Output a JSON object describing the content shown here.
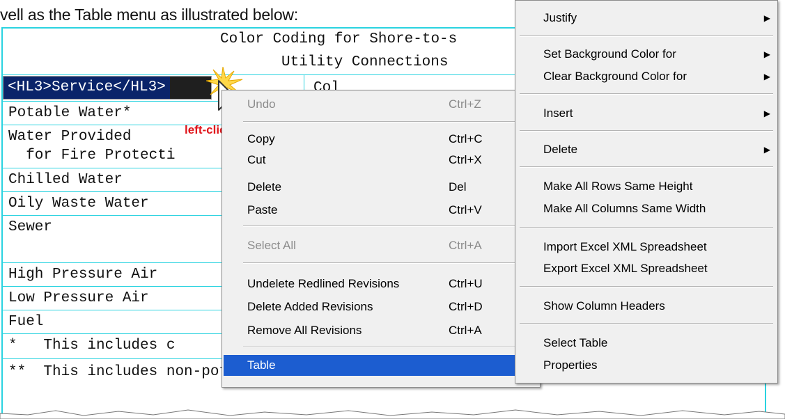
{
  "intro_text": "vell as the Table menu as illustrated below:",
  "document": {
    "title_line1": "Color Coding for Shore-to-s",
    "title_line2": "Utility Connections",
    "selected_cell": "<HL3>Service</HL3>",
    "col2_partial": "Col",
    "rows": [
      "Potable Water*",
      "Water Provided",
      "  for Fire Protecti",
      "Chilled Water",
      "Oily Waste Water",
      "Sewer",
      "",
      "High Pressure Air",
      "Low Pressure Air",
      "Fuel"
    ],
    "footnote1": "*   This includes c",
    "footnote2": "**  This includes non-potalbe salt water or, at some locations,"
  },
  "annotation": "left-click",
  "context_menu": {
    "items": [
      {
        "label": "Undo",
        "shortcut": "Ctrl+Z",
        "disabled": true
      },
      {
        "label": "Copy",
        "shortcut": "Ctrl+C"
      },
      {
        "label": "Cut",
        "shortcut": "Ctrl+X"
      },
      {
        "label": "Delete",
        "shortcut": "Del"
      },
      {
        "label": "Paste",
        "shortcut": "Ctrl+V"
      },
      {
        "label": "Select All",
        "shortcut": "Ctrl+A",
        "disabled": true
      },
      {
        "label": "Undelete Redlined Revisions",
        "shortcut": "Ctrl+U"
      },
      {
        "label": "Delete Added Revisions",
        "shortcut": "Ctrl+D"
      },
      {
        "label": "Remove All Revisions",
        "shortcut": "Ctrl+A"
      },
      {
        "label": "Table",
        "submenu_arrow": "▶",
        "highlighted": true
      }
    ]
  },
  "table_submenu": {
    "items": [
      {
        "label": "Justify",
        "arrow": "▶"
      },
      {
        "label": "Set Background Color for",
        "arrow": "▶"
      },
      {
        "label": "Clear Background Color for",
        "arrow": "▶"
      },
      {
        "label": "Insert",
        "arrow": "▶"
      },
      {
        "label": "Delete",
        "arrow": "▶"
      },
      {
        "label": "Make All Rows Same Height"
      },
      {
        "label": "Make All Columns Same Width"
      },
      {
        "label": "Import Excel XML Spreadsheet"
      },
      {
        "label": "Export Excel XML Spreadsheet"
      },
      {
        "label": "Show Column Headers"
      },
      {
        "label": "Select Table"
      },
      {
        "label": "Properties"
      }
    ]
  },
  "colors": {
    "table_border": "#2ad3e0",
    "menu_highlight": "#1c5dd0",
    "annotation": "#e0141a"
  }
}
